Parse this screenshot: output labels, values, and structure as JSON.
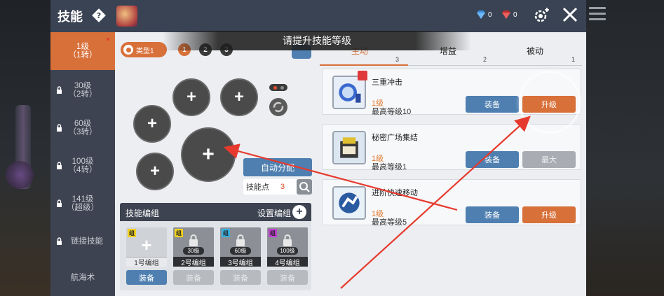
{
  "header": {
    "title": "技能",
    "currency": [
      {
        "value": "0",
        "color": "#3a8fe0"
      },
      {
        "value": "0",
        "color": "#e03a3a"
      }
    ]
  },
  "sidebar": {
    "items": [
      {
        "line1": "1级",
        "line2": "（1转）",
        "locked": false,
        "active": true
      },
      {
        "line1": "30级",
        "line2": "（2转）",
        "locked": true,
        "active": false
      },
      {
        "line1": "60级",
        "line2": "（3转）",
        "locked": true,
        "active": false
      },
      {
        "line1": "100级",
        "line2": "（4转）",
        "locked": true,
        "active": false
      },
      {
        "line1": "141级",
        "line2": "（超级）",
        "locked": true,
        "active": false
      },
      {
        "line1": "链接技能",
        "line2": "",
        "locked": true,
        "active": false
      },
      {
        "line1": "航海术",
        "line2": "",
        "locked": false,
        "active": false
      }
    ]
  },
  "middle": {
    "type_label": "类型1",
    "pages": [
      "1",
      "2",
      "3"
    ],
    "auto_assign_label": "自动分配",
    "skill_points_label": "技能点",
    "skill_points_value": "3",
    "group": {
      "title": "技能编组",
      "settings_label": "设置编组",
      "slots": [
        {
          "caption": "1号编组",
          "level": "",
          "locked": false,
          "button": "装备"
        },
        {
          "caption": "2号编组",
          "level": "30级",
          "locked": true,
          "button": "装备"
        },
        {
          "caption": "3号编组",
          "level": "60级",
          "locked": true,
          "button": "装备"
        },
        {
          "caption": "4号编组",
          "level": "100级",
          "locked": true,
          "button": "装备"
        }
      ],
      "tag_colors": [
        "#f2d21f",
        "#f2d21f",
        "#3ab0e0",
        "#c040d0"
      ]
    }
  },
  "banner": "请提升技能等级",
  "tabs": [
    {
      "label": "主动",
      "count": "3",
      "active": true
    },
    {
      "label": "增益",
      "count": "2",
      "active": false
    },
    {
      "label": "被动",
      "count": "1",
      "active": false
    }
  ],
  "skills": [
    {
      "name": "三重冲击",
      "level": "1级",
      "max": "最高等级10",
      "equip": "装备",
      "upgrade": "升级",
      "maxed": false
    },
    {
      "name": "秘密广场集结",
      "level": "1级",
      "max": "最高等级1",
      "equip": "装备",
      "upgrade": "最大",
      "maxed": true
    },
    {
      "name": "进阶快速移动",
      "level": "1级",
      "max": "最高等级5",
      "equip": "装备",
      "upgrade": "升级",
      "maxed": false
    }
  ],
  "colors": {
    "accent": "#d8703a",
    "button_blue": "#4e7fb0",
    "annotation_red": "#e63a2e"
  }
}
